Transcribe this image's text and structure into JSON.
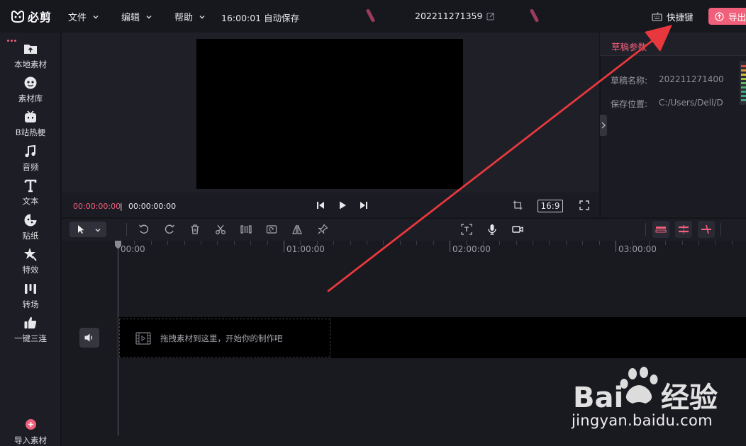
{
  "app": {
    "name": "必剪"
  },
  "menubar": [
    {
      "label": "文件"
    },
    {
      "label": "编辑"
    },
    {
      "label": "帮助"
    }
  ],
  "autosave": "16:00:01 自动保存",
  "project_title": "202211271359",
  "shortcut_label": "快捷键",
  "export_label": "导出",
  "sidebar": {
    "items": [
      {
        "label": "本地素材",
        "icon": "upload-folder-icon"
      },
      {
        "label": "素材库",
        "icon": "material-library-icon"
      },
      {
        "label": "B站热梗",
        "icon": "tv-icon"
      },
      {
        "label": "音频",
        "icon": "music-note-icon"
      },
      {
        "label": "文本",
        "icon": "text-icon"
      },
      {
        "label": "贴纸",
        "icon": "sticker-icon"
      },
      {
        "label": "特效",
        "icon": "effect-star-icon"
      },
      {
        "label": "转场",
        "icon": "transition-icon"
      },
      {
        "label": "一键三连",
        "icon": "thumbs-up-icon"
      }
    ],
    "import_label": "导入素材"
  },
  "player": {
    "current_time": "00:00:00:00",
    "separator": "|",
    "total_time": "00:00:00:00",
    "aspect_ratio": "16:9"
  },
  "right_panel": {
    "tab_label": "草稿参数",
    "fields": [
      {
        "label": "草稿名称:",
        "value": "202211271400"
      },
      {
        "label": "保存位置:",
        "value": "C:/Users/Dell/D"
      }
    ]
  },
  "timeline": {
    "ruler_labels": [
      "00:00",
      "01:00:00",
      "02:00:00",
      "03:00:00"
    ],
    "drop_hint": "拖拽素材到这里，开始你的制作吧"
  },
  "watermark": {
    "brand_text": "Baidu经验",
    "url": "jingyan.baidu.com"
  },
  "colors": {
    "accent": "#f0607a",
    "background": "#15151c",
    "annotation_arrow": "#e8383d"
  }
}
